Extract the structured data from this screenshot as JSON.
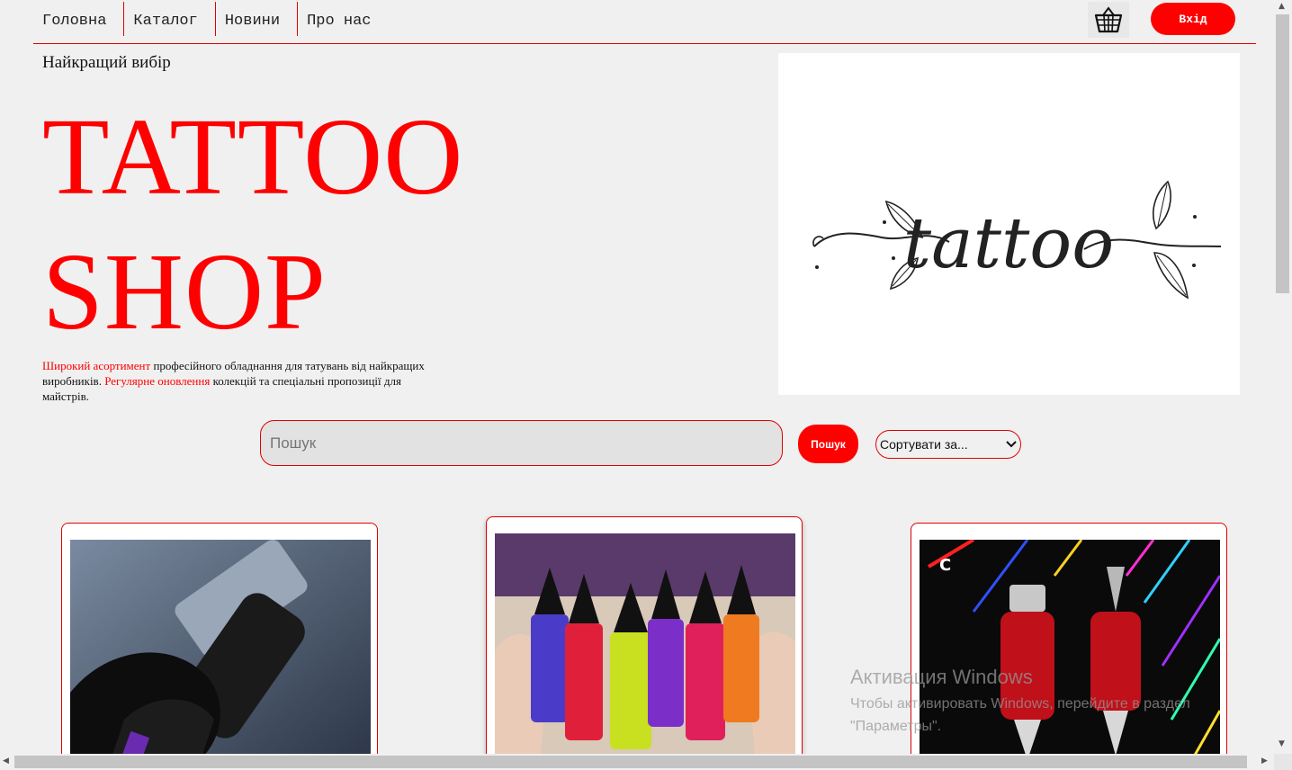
{
  "nav": {
    "links": [
      "Головна",
      "Каталог",
      "Новини",
      "Про нас"
    ],
    "cart_icon": "basket-icon",
    "login_label": "Вхід"
  },
  "hero": {
    "subtitle": "Найкращий вибір",
    "title_line1": "TATTOO",
    "title_line2": "SHOP",
    "desc_red1": "Широкий асортимент",
    "desc_text1": " професійного обладнання для татувань від найкращих виробників. ",
    "desc_red2": "Регулярне оновлення",
    "desc_text2": " колекцій та спеціальні пропозиції для майстрів.",
    "image_text": "tattoo"
  },
  "search": {
    "placeholder": "Пошук",
    "button_label": "Пошук",
    "sort_label": "Сортувати за..."
  },
  "watermark": {
    "title": "Активация Windows",
    "line1": "Чтобы активировать Windows, перейдите в раздел",
    "line2": "\"Параметры\"."
  },
  "colors": {
    "accent": "#ff0000",
    "background": "#f0f0f0"
  }
}
